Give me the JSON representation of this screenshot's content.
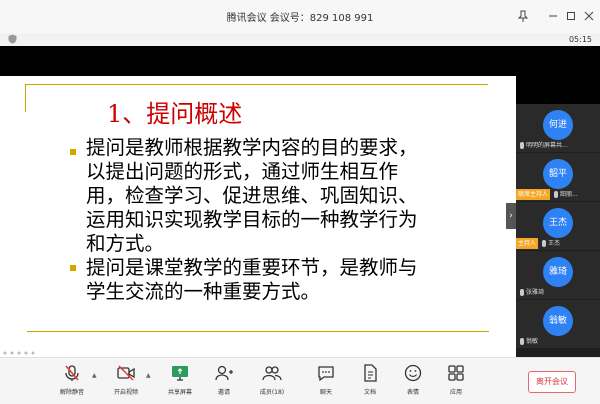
{
  "titlebar": {
    "title": "腾讯会议 会议号：829 108 991"
  },
  "status": {
    "timer": "05:15"
  },
  "slide": {
    "heading": "1、提问概述",
    "paragraph1": "提问是教师根据教学内容的目的要求，以提出问题的形式，通过师生相互作用，检查学习、促进思维、巩固知识、运用知识实现教学目标的一种教学行为和方式。",
    "paragraph2": "提问是课堂教学的重要环节，是教师与学生交流的一种重要方式。",
    "accent_color": "#cc0000",
    "bullet_color": "#d7a300"
  },
  "participants": [
    {
      "avatar_text": "何进",
      "label": "明明的屏幕共...",
      "tag": ""
    },
    {
      "avatar_text": "韶平",
      "label": "韶丽...",
      "tag": "联席主持人"
    },
    {
      "avatar_text": "王杰",
      "label": "王杰",
      "tag": "主持人"
    },
    {
      "avatar_text": "雅琦",
      "label": "张雅琦",
      "tag": ""
    },
    {
      "avatar_text": "翁敏",
      "label": "翁敏",
      "tag": ""
    }
  ],
  "toolbar": {
    "mute_label": "解除静音",
    "video_label": "开启视频",
    "share_label": "共享屏幕",
    "invite_label": "邀请",
    "members_label": "成员(18)",
    "chat_label": "聊天",
    "docs_label": "文档",
    "reactions_label": "表情",
    "apps_label": "应用",
    "leave_label": "离开会议"
  },
  "colors": {
    "avatar_blue": "#2f82f4",
    "host_tag": "#f5a623",
    "leave_red": "#d9363e"
  }
}
